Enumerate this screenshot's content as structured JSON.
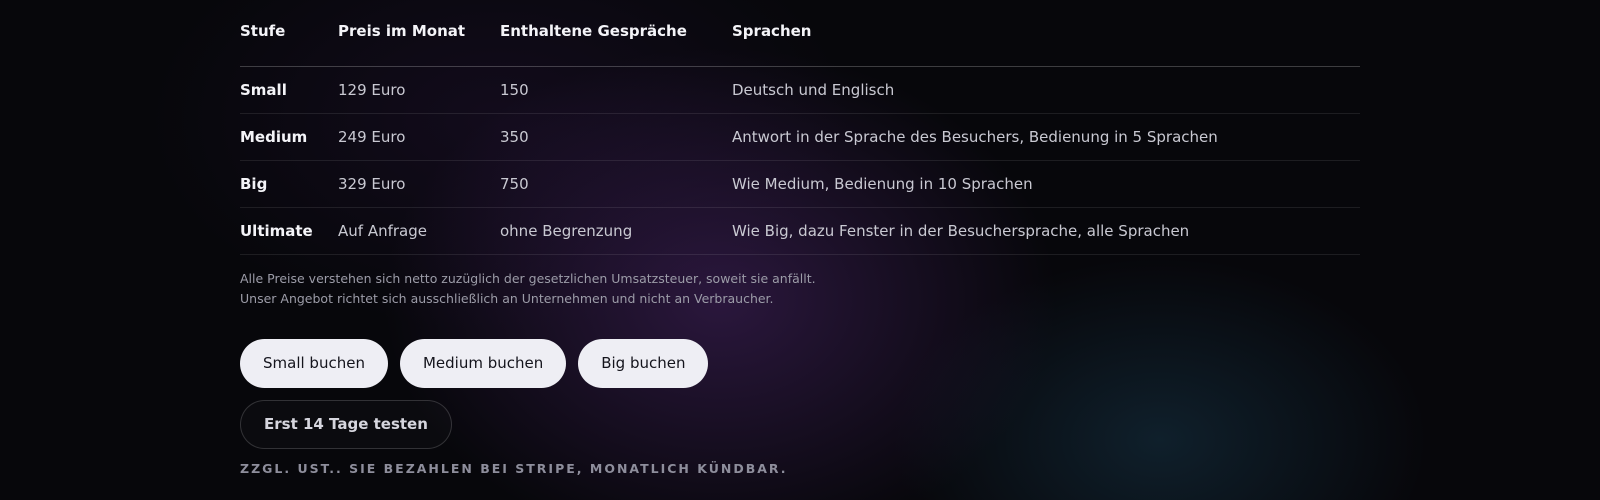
{
  "table": {
    "headers": [
      "Stufe",
      "Preis im Monat",
      "Enthaltene Gespräche",
      "Sprachen"
    ],
    "rows": [
      [
        "Small",
        "129 Euro",
        "150",
        "Deutsch und Englisch"
      ],
      [
        "Medium",
        "249 Euro",
        "350",
        "Antwort in der Sprache des Besuchers, Bedienung in 5 Sprachen"
      ],
      [
        "Big",
        "329 Euro",
        "750",
        "Wie Medium, Bedienung in 10 Sprachen"
      ],
      [
        "Ultimate",
        "Auf Anfrage",
        "ohne Begrenzung",
        "Wie Big, dazu Fenster in der Besuchersprache, alle Sprachen"
      ]
    ]
  },
  "notes": {
    "vat": "Alle Preise verstehen sich netto zuzüglich der gesetzlichen Umsatzsteuer, soweit sie anfällt.",
    "b2b": "Unser Angebot richtet sich ausschließlich an Unternehmen und nicht an Verbraucher."
  },
  "buttons": {
    "small": "Small buchen",
    "medium": "Medium buchen",
    "big": "Big buchen",
    "trial": "Erst 14 Tage testen"
  },
  "fineprint": "ZZGL. UST.. SIE BEZAHLEN BEI STRIPE, MONATLICH KÜNDBAR."
}
